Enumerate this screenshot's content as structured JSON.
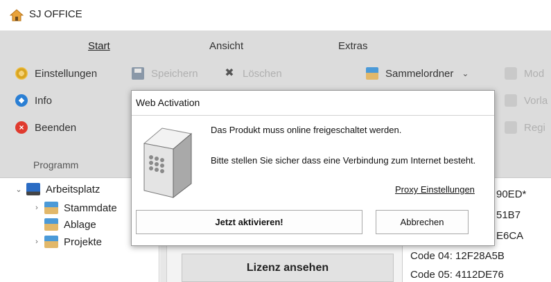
{
  "window": {
    "title": "SJ OFFICE"
  },
  "ribbon": {
    "tabs": [
      {
        "label": "Start"
      },
      {
        "label": "Ansicht"
      },
      {
        "label": "Extras"
      }
    ],
    "programm_group": {
      "label": "Programm",
      "buttons": {
        "einstellungen": "Einstellungen",
        "info": "Info",
        "beenden": "Beenden"
      }
    },
    "edit_group": {
      "speichern": "Speichern",
      "loeschen": "Löschen"
    },
    "folder_group": {
      "sammelordner": "Sammelordner",
      "mod": "Mod",
      "vorla": "Vorla",
      "regi": "Regi"
    }
  },
  "tree": {
    "root": "Arbeitsplatz",
    "children": [
      "Stammdate",
      "Ablage",
      "Projekte"
    ]
  },
  "content": {
    "lizenz_button": "Lizenz ansehen",
    "codes": [
      "90ED*",
      "51B7",
      "E6CA",
      "Code 04: 12F28A5B",
      "Code 05: 4112DE76"
    ]
  },
  "dialog": {
    "title": "Web Activation",
    "message1": "Das Produkt muss online freigeschaltet werden.",
    "message2": "Bitte stellen Sie sicher dass eine Verbindung zum Internet besteht.",
    "proxy_link": "Proxy Einstellungen",
    "activate_button": "Jetzt aktivieren!",
    "cancel_button": "Abbrechen"
  }
}
